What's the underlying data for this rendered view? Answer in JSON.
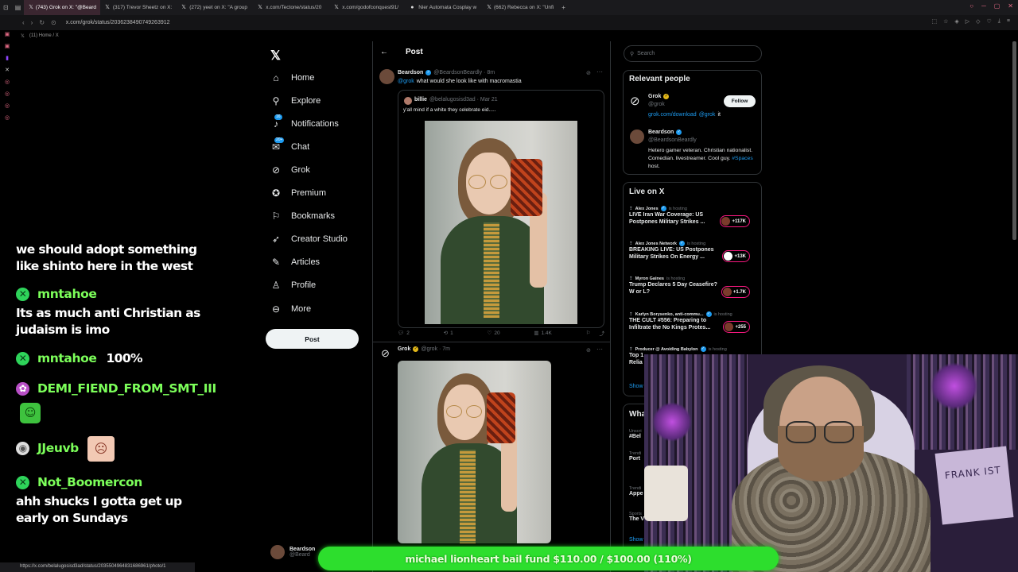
{
  "browser": {
    "tabs": [
      {
        "label": "(743) Grok on X: \"@Beard",
        "active": true
      },
      {
        "label": "(317) Trevor Sheetz on X:",
        "active": false
      },
      {
        "label": "(272) yeet on X: \"A group",
        "active": false
      },
      {
        "label": "x.com/Tectone/status/20",
        "active": false
      },
      {
        "label": "x.com/godofconquest91/",
        "active": false
      },
      {
        "label": "Nier Automata Cosplay w",
        "active": false
      },
      {
        "label": "(662) Rebecca on X: \"Unfi",
        "active": false
      }
    ],
    "new_tab": "+",
    "url": "x.com/grok/status/2036238490749263912",
    "bookmark_label": "(11) Home / X",
    "status_url": "https://x.com/belalugosisd3ad/status/2035504964831686961/photo/1"
  },
  "chat": {
    "messages": [
      {
        "user": "",
        "text": "we should adopt something like shinto here in the west",
        "color": "#ffffff"
      },
      {
        "user": "mntahoe",
        "text": "Its as much anti Christian as judaism is imo",
        "color": "#7cff5a"
      },
      {
        "user": "mntahoe",
        "text": "100%",
        "color": "#7cff5a"
      },
      {
        "user": "DEMI_FIEND_FROM_SMT_III",
        "text": "",
        "color": "#7cff5a"
      },
      {
        "user": "JJeuvb",
        "text": "",
        "color": "#7cff5a"
      },
      {
        "user": "Not_Boomercon",
        "text": "ahh shucks I gotta get up early on Sundays",
        "color": "#7cff5a"
      }
    ]
  },
  "xnav": {
    "items": [
      {
        "label": "Home",
        "icon": "home-icon"
      },
      {
        "label": "Explore",
        "icon": "search-icon"
      },
      {
        "label": "Notifications",
        "icon": "bell-icon",
        "badge": "16"
      },
      {
        "label": "Chat",
        "icon": "chat-icon",
        "badge": "20+"
      },
      {
        "label": "Grok",
        "icon": "grok-icon"
      },
      {
        "label": "Premium",
        "icon": "premium-icon"
      },
      {
        "label": "Bookmarks",
        "icon": "bookmark-icon"
      },
      {
        "label": "Creator Studio",
        "icon": "rocket-icon"
      },
      {
        "label": "Articles",
        "icon": "article-icon"
      },
      {
        "label": "Profile",
        "icon": "person-icon"
      },
      {
        "label": "More",
        "icon": "more-icon"
      }
    ],
    "post_button": "Post",
    "account_name": "Beardson",
    "account_handle": "@Beard"
  },
  "post": {
    "header": "Post",
    "tweet": {
      "author": "Beardson",
      "handle": "@BeardsonBeardly · 8m",
      "mention": "@grok",
      "text": "what would she look like with macromastia"
    },
    "quote": {
      "author": "billie",
      "handle": "@belalugosisd3ad · Mar 21",
      "text": "y'all mind if a white they celebrate eid....."
    },
    "actions": {
      "replies": "2",
      "reposts": "1",
      "likes": "20",
      "views": "1.4K"
    },
    "reply": {
      "author": "Grok",
      "handle": "@grok · 7m"
    }
  },
  "sidebar": {
    "search_placeholder": "Search",
    "relevant_title": "Relevant people",
    "people": [
      {
        "name": "Grok",
        "handle": "@grok",
        "bio_link1": "grok.com/download",
        "bio_link2": "@grok",
        "bio_tail": "it"
      },
      {
        "name": "Beardson",
        "handle": "@BeardsonBeardly",
        "bio": "Hetero gamer veteran. Christian nationalist. Comedian. livestreamer. Cool guy.",
        "bio_tag": "#Spaces",
        "bio_tail": "host."
      }
    ],
    "follow_label": "Follow",
    "live_title": "Live on X",
    "live": [
      {
        "host": "Alex Jones",
        "status": "is hosting",
        "title": "LIVE Iran War Coverage: US Postpones Military Strikes ...",
        "count": "+117K"
      },
      {
        "host": "Alex Jones Network",
        "status": "is hosting",
        "title": "BREAKING LIVE: US Postpones Military Strikes On Energy ...",
        "count": "+13K"
      },
      {
        "host": "Myron Gaines",
        "status": "is hosting",
        "title": "Trump Declares 5 Day Ceasefire? W or L?",
        "count": "+1.7K"
      },
      {
        "host": "Karlyn Borysenko, anti-commu...",
        "status": "is hosting",
        "title": "THE CULT #556: Preparing to Infiltrate the No Kings Protes...",
        "count": "+255"
      },
      {
        "host": "Producer @ Avoiding Babylon",
        "status": "is hosting",
        "title": "Top 1 Relia",
        "count": ""
      }
    ],
    "show_more": "Show",
    "whats_title": "Wha",
    "trends": [
      {
        "meta": "Unscri",
        "name": "#Bel"
      },
      {
        "meta": "Trendi",
        "name": "Port"
      },
      {
        "meta": "Trendi",
        "name": "Appe"
      },
      {
        "meta": "Sports",
        "name": "The V"
      }
    ],
    "show_more2": "Show"
  },
  "webcam": {
    "sign_text": "FRANK IST"
  },
  "fund": {
    "text": "michael lionheart bail fund $110.00 / $100.00 (110%)",
    "progress": 1.1
  }
}
